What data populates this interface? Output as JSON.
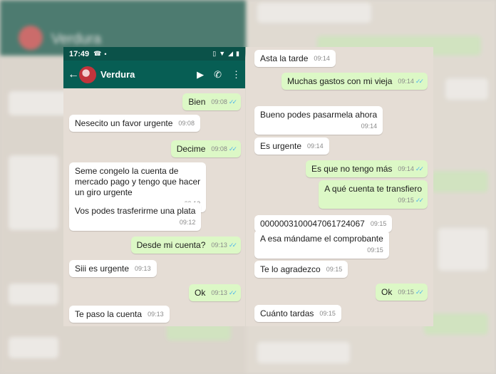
{
  "status": {
    "time": "17:49",
    "icons": [
      "whatsapp-icon",
      "dot-icon",
      "vibrate-icon",
      "wifi-icon",
      "signal-icon",
      "battery-icon"
    ]
  },
  "header": {
    "contact": "Verdura",
    "back_icon": "back-arrow-icon",
    "video_icon": "video-call-icon",
    "call_icon": "phone-icon",
    "menu_icon": "more-vert-icon"
  },
  "colors": {
    "header": "#075e54",
    "status": "#0b5249",
    "outgoing": "#dcf8c6",
    "incoming": "#ffffff",
    "chat_bg": "#e5ddd5",
    "read_ticks": "#4fb6ec"
  },
  "left_chat": [
    {
      "dir": "out",
      "text": "Bien",
      "time": "09:08",
      "read": true
    },
    {
      "dir": "in",
      "text": "Nesecito un favor urgente",
      "time": "09:08"
    },
    {
      "dir": "out",
      "text": "Decime",
      "time": "09:08",
      "read": true
    },
    {
      "dir": "in",
      "text": "Seme congelo la cuenta de\nmercado pago y tengo que hacer\nun giro urgente",
      "time": "09:12"
    },
    {
      "dir": "in",
      "text": "Vos podes trasferirme una plata",
      "time": "09:12"
    },
    {
      "dir": "out",
      "text": "Desde mi cuenta?",
      "time": "09:13",
      "read": true
    },
    {
      "dir": "in",
      "text": "Siii es urgente",
      "time": "09:13"
    },
    {
      "dir": "out",
      "text": "Ok",
      "time": "09:13",
      "read": true
    },
    {
      "dir": "in",
      "text": "Te paso la cuenta",
      "time": "09:13"
    }
  ],
  "right_chat": [
    {
      "dir": "in",
      "text": "Asta la tarde",
      "time": "09:14"
    },
    {
      "dir": "out",
      "text": "Muchas gastos con mi vieja",
      "time": "09:14",
      "read": true
    },
    {
      "dir": "in",
      "text": "Bueno podes pasarmela ahora",
      "time": "09:14"
    },
    {
      "dir": "in",
      "text": "Es urgente",
      "time": "09:14"
    },
    {
      "dir": "out",
      "text": "Es que no tengo más",
      "time": "09:14",
      "read": true
    },
    {
      "dir": "out",
      "text": "A qué cuenta te transfiero",
      "time": "09:15",
      "read": true
    },
    {
      "dir": "in",
      "text": "0000003100047061724067",
      "time": "09:15"
    },
    {
      "dir": "in",
      "text": "A esa mándame el comprobante",
      "time": "09:15"
    },
    {
      "dir": "in",
      "text": "Te lo agradezco",
      "time": "09:15"
    },
    {
      "dir": "out",
      "text": "Ok",
      "time": "09:15",
      "read": true
    },
    {
      "dir": "in",
      "text": "Cuánto tardas",
      "time": "09:15"
    }
  ],
  "backdrop": {
    "title": "Verdura"
  }
}
